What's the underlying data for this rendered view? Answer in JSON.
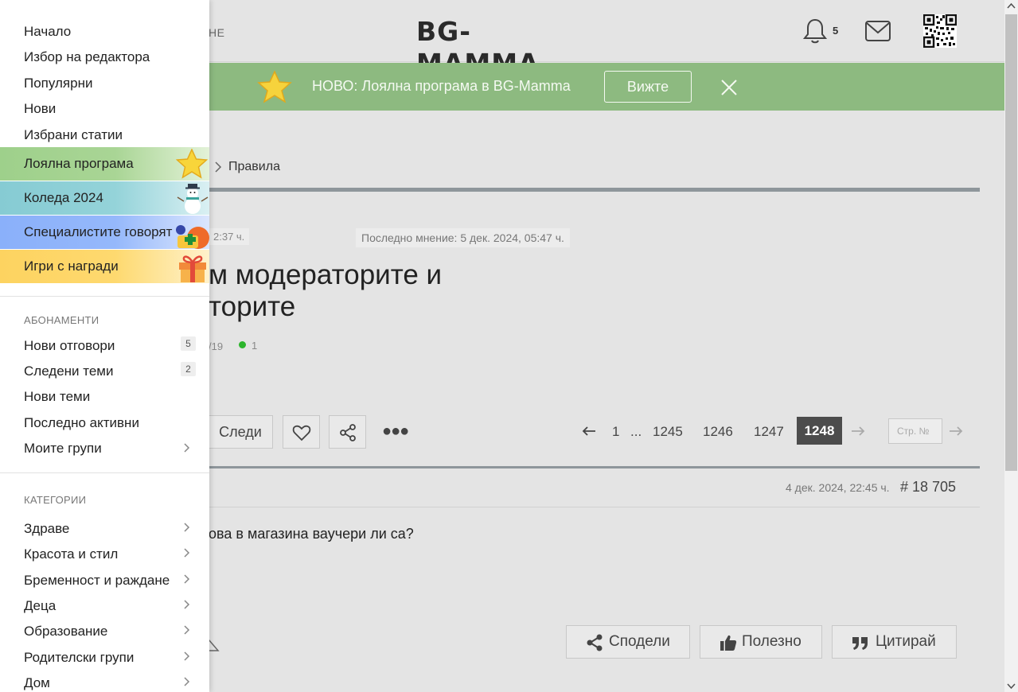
{
  "header": {
    "nav_fragment": "НЕ",
    "logo": "BG-MAMMA",
    "notifications_count": "5"
  },
  "promo": {
    "text": "НОВО: Лоялна програма в BG-Mamma",
    "button": "Вижте"
  },
  "breadcrumb": {
    "current": "Правила"
  },
  "topic": {
    "created_fragment": "2:37 ч.",
    "last_post": "Последно мнение: 5 дек. 2024, 05:47 ч.",
    "title_line1": "м модераторите и",
    "title_line2": "торите",
    "stat_fragment": "/19",
    "online_count": "1"
  },
  "actions": {
    "follow": "Следи"
  },
  "pagination": {
    "first": "1",
    "ellipsis": "...",
    "pages": [
      "1245",
      "1246",
      "1247"
    ],
    "current": "1248",
    "page_placeholder": "Стр. №"
  },
  "post": {
    "date": "4 дек. 2024, 22:45 ч.",
    "number": "# 18 705",
    "text": "ова в магазина ваучери ли са?",
    "share": "Сподели",
    "useful": "Полезно",
    "quote": "Цитирай"
  },
  "menu": {
    "items": [
      "Начало",
      "Избор на редактора",
      "Популярни",
      "Нови",
      "Избрани статии"
    ],
    "highlights": [
      {
        "label": "Лоялна програма",
        "color": "#a4d28f"
      },
      {
        "label": "Коледа 2024",
        "color": "#8fd0d6"
      },
      {
        "label": "Специалистите говорят",
        "color": "#8fb4fb"
      },
      {
        "label": "Игри с награди",
        "color": "#fdd567"
      }
    ],
    "subs_title": "АБОНАМЕНТИ",
    "subs": [
      {
        "label": "Нови отговори",
        "badge": "5"
      },
      {
        "label": "Следени теми",
        "badge": "2"
      },
      {
        "label": "Нови теми"
      },
      {
        "label": "Последно активни"
      },
      {
        "label": "Моите групи"
      }
    ],
    "cats_title": "КАТЕГОРИИ",
    "cats": [
      "Здраве",
      "Красота и стил",
      "Бременност и раждане",
      "Деца",
      "Образование",
      "Родителски групи",
      "Дом"
    ]
  }
}
